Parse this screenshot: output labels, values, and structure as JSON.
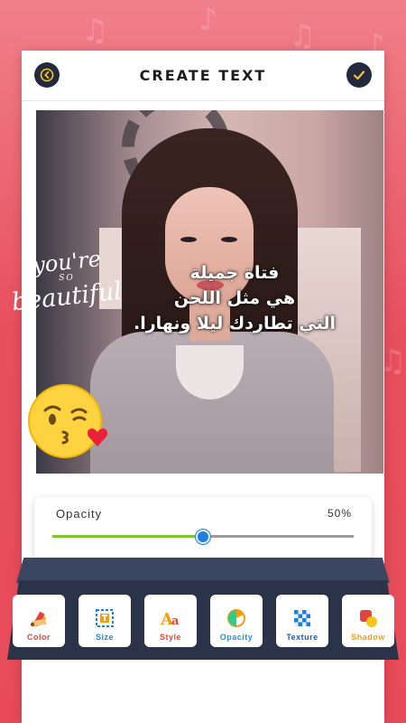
{
  "header": {
    "title": "CREATE TEXT"
  },
  "overlay_text": {
    "arabic_lines": [
      "فتاة جميلة",
      "هي مثل اللحن",
      "التي تطاردك ليلا ونهارا."
    ],
    "sticker": {
      "line1": "you're",
      "line2": "SO",
      "line3": "beautiful"
    }
  },
  "opacity": {
    "label": "Opacity",
    "value_text": "50%",
    "value": 0.5
  },
  "toolbar": {
    "tools": [
      {
        "label": "Color",
        "color": "#e0463c"
      },
      {
        "label": "Size",
        "color": "#1e7fd8"
      },
      {
        "label": "Style",
        "color": "#e0463c"
      },
      {
        "label": "Opacity",
        "color": "#2b8fcf"
      },
      {
        "label": "Texture",
        "color": "#1e7fd8"
      },
      {
        "label": "Shadow",
        "color": "#f39c12"
      }
    ]
  },
  "colors": {
    "accent_dark": "#232a3e",
    "slider_fill": "#7bc628",
    "slider_thumb": "#1f7fe0",
    "check": "#f5c518"
  }
}
